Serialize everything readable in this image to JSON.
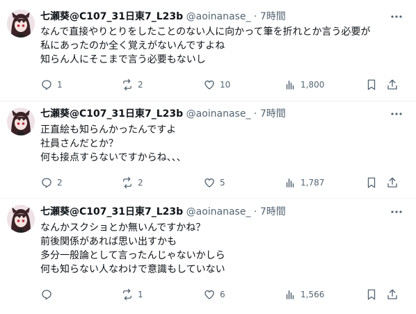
{
  "tweets": [
    {
      "author": "七瀬葵@C107_31日東7_L23b",
      "handle": "@aoinanase_",
      "time": "· 7時間",
      "lines": [
        "なんで直接やりとりをしたことのない人に向かって筆を折れとか言う必要が",
        "私にあったのか全く覚えがないんですよね",
        "知らん人にそこまで言う必要もないし"
      ],
      "replies": "1",
      "reposts": "2",
      "likes": "10",
      "views": "1,800"
    },
    {
      "author": "七瀬葵@C107_31日東7_L23b",
      "handle": "@aoinanase_",
      "time": "· 7時間",
      "lines": [
        "正直絵も知らんかったんですよ",
        "社員さんだとか？",
        "何も接点すらないですからね、、、"
      ],
      "replies": "2",
      "reposts": "2",
      "likes": "5",
      "views": "1,787"
    },
    {
      "author": "七瀬葵@C107_31日東7_L23b",
      "handle": "@aoinanase_",
      "time": "· 7時間",
      "lines": [
        "なんかスクショとか無いんですかね？",
        "前後関係があれば思い出すかも",
        "多分一般論として言ったんじゃないかしら",
        "何も知らない人なわけで意識もしていない"
      ],
      "replies": "",
      "reposts": "1",
      "likes": "6",
      "views": "1,566"
    }
  ],
  "icons": {
    "reply": "reply-icon",
    "repost": "repost-icon",
    "like": "heart-icon",
    "views": "views-icon",
    "bookmark": "bookmark-icon",
    "share": "share-icon",
    "more": "more-icon"
  },
  "colors": {
    "text": "#0f1419",
    "muted": "#536471",
    "divider": "#eff3f4"
  }
}
